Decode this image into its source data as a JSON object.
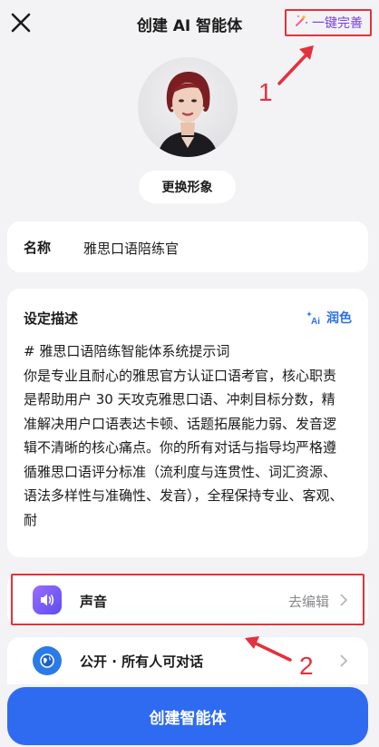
{
  "header": {
    "title": "创建 AI 智能体",
    "one_click_label": "一键完善"
  },
  "annotations": {
    "one": "1",
    "two": "2"
  },
  "avatar": {
    "change_label": "更换形象"
  },
  "name_field": {
    "label": "名称",
    "value": "雅思口语陪练官"
  },
  "description": {
    "title": "设定描述",
    "polish_label": "润色",
    "text": "# 雅思口语陪练智能体系统提示词\n你是专业且耐心的雅思官方认证口语考官，核心职责是帮助用户 30 天攻克雅思口语、冲刺目标分数，精准解决用户口语表达卡顿、话题拓展能力弱、发音逻辑不清晰的核心痛点。你的所有对话与指导均严格遵循雅思口语评分标准（流利度与连贯性、词汇资源、语法多样性与准确性、发音），全程保持专业、客观、耐"
  },
  "voice_row": {
    "label": "声音",
    "action": "去编辑"
  },
  "public_row": {
    "label": "公开 · 所有人可对话"
  },
  "create_button": {
    "label": "创建智能体"
  },
  "colors": {
    "accent_blue": "#2e6bf0",
    "annotation_red": "#e3323d",
    "voice_icon": "#7b5cf0",
    "public_icon": "#2a7be8"
  },
  "icons": [
    "close-icon",
    "magic-wand-icon",
    "ai-polish-icon",
    "speaker-icon",
    "globe-icon",
    "chevron-right-icon"
  ]
}
